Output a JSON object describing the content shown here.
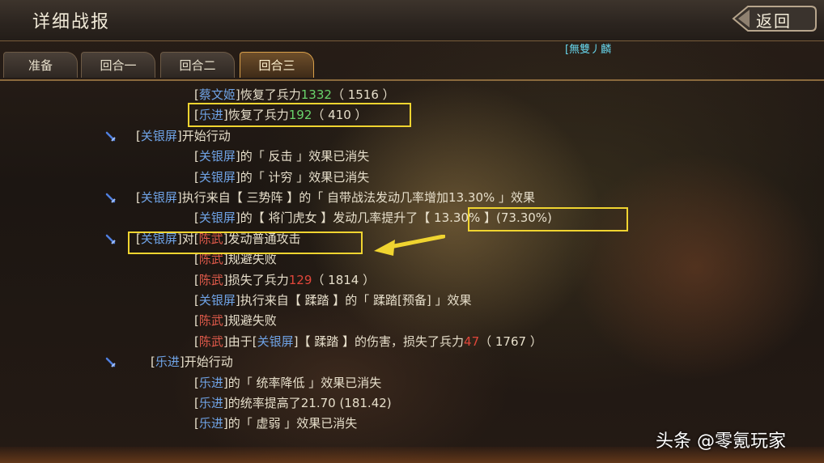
{
  "header": {
    "title": "详细战报",
    "back_label": "返回",
    "player_tag": "[無雙丿麟"
  },
  "tabs": [
    {
      "label": "准备",
      "active": false
    },
    {
      "label": "回合一",
      "active": false
    },
    {
      "label": "回合二",
      "active": false
    },
    {
      "label": "回合三",
      "active": true
    }
  ],
  "log": [
    {
      "indent": 2,
      "parts": [
        [
          "[",
          "bracket"
        ],
        [
          "蔡文姬",
          "ally"
        ],
        [
          "]",
          "bracket"
        ],
        [
          "恢复了兵力",
          ""
        ],
        [
          "1332",
          "green"
        ],
        [
          "（ 1516 ）",
          ""
        ]
      ]
    },
    {
      "indent": 2,
      "parts": [
        [
          "[",
          "bracket"
        ],
        [
          "乐进",
          "ally"
        ],
        [
          "]",
          "bracket"
        ],
        [
          "恢复了兵力",
          ""
        ],
        [
          "192",
          "green"
        ],
        [
          "（ 410 ）",
          ""
        ]
      ]
    },
    {
      "indent": 1,
      "icon": true,
      "parts": [
        [
          "[",
          "bracket"
        ],
        [
          "关银屏",
          "ally"
        ],
        [
          "]",
          "bracket"
        ],
        [
          "开始行动",
          ""
        ]
      ]
    },
    {
      "indent": 2,
      "parts": [
        [
          "[",
          "bracket"
        ],
        [
          "关银屏",
          "ally"
        ],
        [
          "]",
          "bracket"
        ],
        [
          "的「 反击 」效果已消失",
          ""
        ]
      ]
    },
    {
      "indent": 2,
      "parts": [
        [
          "[",
          "bracket"
        ],
        [
          "关银屏",
          "ally"
        ],
        [
          "]",
          "bracket"
        ],
        [
          "的「 计穷 」效果已消失",
          ""
        ]
      ]
    },
    {
      "indent": 1,
      "icon": true,
      "parts": [
        [
          "[",
          "bracket"
        ],
        [
          "关银屏",
          "ally"
        ],
        [
          "]",
          "bracket"
        ],
        [
          "执行来自【 三势阵 】的「 自带战法发动几率增加13.30% 」效果",
          ""
        ]
      ]
    },
    {
      "indent": 2,
      "parts": [
        [
          "[",
          "bracket"
        ],
        [
          "关银屏",
          "ally"
        ],
        [
          "]",
          "bracket"
        ],
        [
          "的【 将门虎女 】发动几率提升了【 13.30% 】(73.30%)",
          ""
        ]
      ]
    },
    {
      "indent": 1,
      "icon": true,
      "parts": [
        [
          "[",
          "bracket"
        ],
        [
          "关银屏",
          "ally"
        ],
        [
          "]",
          "bracket"
        ],
        [
          "对",
          ""
        ],
        [
          "[",
          "bracket"
        ],
        [
          "陈武",
          "enemy"
        ],
        [
          "]",
          "bracket"
        ],
        [
          "发动普通攻击",
          ""
        ]
      ]
    },
    {
      "indent": 2,
      "parts": [
        [
          "[",
          "bracket"
        ],
        [
          "陈武",
          "enemy"
        ],
        [
          "]",
          "bracket"
        ],
        [
          "规避失败",
          ""
        ]
      ]
    },
    {
      "indent": 2,
      "parts": [
        [
          "[",
          "bracket"
        ],
        [
          "陈武",
          "enemy"
        ],
        [
          "]",
          "bracket"
        ],
        [
          "损失了兵力",
          ""
        ],
        [
          "129",
          "red"
        ],
        [
          "（ 1814 ）",
          ""
        ]
      ]
    },
    {
      "indent": 2,
      "parts": [
        [
          "[",
          "bracket"
        ],
        [
          "关银屏",
          "ally"
        ],
        [
          "]",
          "bracket"
        ],
        [
          "执行来自【 蹂踏 】的「 蹂踏[预备] 」效果",
          ""
        ]
      ]
    },
    {
      "indent": 2,
      "parts": [
        [
          "[",
          "bracket"
        ],
        [
          "陈武",
          "enemy"
        ],
        [
          "]",
          "bracket"
        ],
        [
          "规避失败",
          ""
        ]
      ]
    },
    {
      "indent": 2,
      "parts": [
        [
          "[",
          "bracket"
        ],
        [
          "陈武",
          "enemy"
        ],
        [
          "]",
          "bracket"
        ],
        [
          "由于",
          ""
        ],
        [
          "[",
          "bracket"
        ],
        [
          "关银屏",
          "ally"
        ],
        [
          "]",
          "bracket"
        ],
        [
          "【 蹂踏 】的伤害，损失了兵力",
          ""
        ],
        [
          "47",
          "red"
        ],
        [
          "（ 1767 ）",
          ""
        ]
      ]
    },
    {
      "indent": 1,
      "icon": true,
      "parts": [
        [
          "[",
          "bracket"
        ],
        [
          "乐进",
          "ally"
        ],
        [
          "]",
          "bracket"
        ],
        [
          "开始行动",
          ""
        ]
      ]
    },
    {
      "indent": 2,
      "parts": [
        [
          "[",
          "bracket"
        ],
        [
          "乐进",
          "ally"
        ],
        [
          "]",
          "bracket"
        ],
        [
          "的「 统率降低 」效果已消失",
          ""
        ]
      ]
    },
    {
      "indent": 2,
      "parts": [
        [
          "[",
          "bracket"
        ],
        [
          "乐进",
          "ally"
        ],
        [
          "]",
          "bracket"
        ],
        [
          "的统率提高了21.70 (181.42)",
          ""
        ]
      ]
    },
    {
      "indent": 2,
      "parts": [
        [
          "[",
          "bracket"
        ],
        [
          "乐进",
          "ally"
        ],
        [
          "]",
          "bracket"
        ],
        [
          "的「 虚弱 」效果已消失",
          ""
        ]
      ]
    }
  ],
  "watermark": "头条 @零氪玩家",
  "colors": {
    "ally": "#6fa3e6",
    "enemy": "#e05a4a",
    "heal": "#69d36b",
    "damage": "#e0463a",
    "highlight": "#f0d430",
    "player_tag": "#66d4ea"
  },
  "icons": {
    "action_marker": "sword-icon",
    "back": "back-arrow-icon"
  }
}
